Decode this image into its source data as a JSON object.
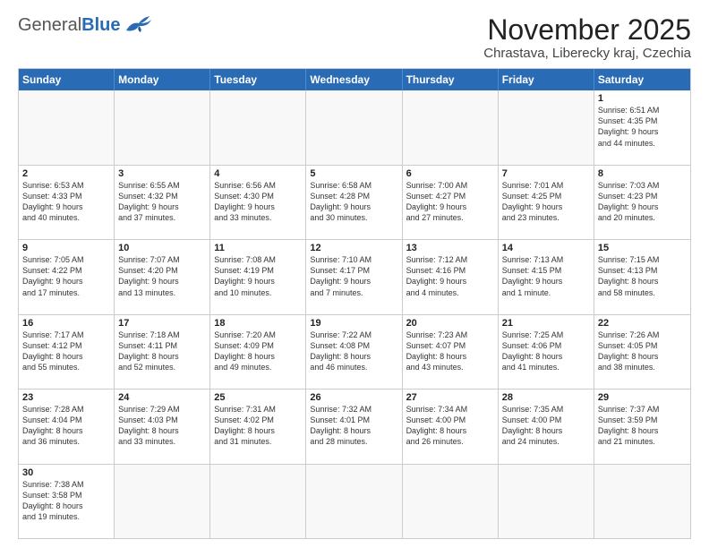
{
  "header": {
    "logo_general": "General",
    "logo_blue": "Blue",
    "title": "November 2025",
    "subtitle": "Chrastava, Liberecky kraj, Czechia"
  },
  "weekdays": [
    "Sunday",
    "Monday",
    "Tuesday",
    "Wednesday",
    "Thursday",
    "Friday",
    "Saturday"
  ],
  "rows": [
    [
      {
        "day": "",
        "info": ""
      },
      {
        "day": "",
        "info": ""
      },
      {
        "day": "",
        "info": ""
      },
      {
        "day": "",
        "info": ""
      },
      {
        "day": "",
        "info": ""
      },
      {
        "day": "",
        "info": ""
      },
      {
        "day": "1",
        "info": "Sunrise: 6:51 AM\nSunset: 4:35 PM\nDaylight: 9 hours\nand 44 minutes."
      }
    ],
    [
      {
        "day": "2",
        "info": "Sunrise: 6:53 AM\nSunset: 4:33 PM\nDaylight: 9 hours\nand 40 minutes."
      },
      {
        "day": "3",
        "info": "Sunrise: 6:55 AM\nSunset: 4:32 PM\nDaylight: 9 hours\nand 37 minutes."
      },
      {
        "day": "4",
        "info": "Sunrise: 6:56 AM\nSunset: 4:30 PM\nDaylight: 9 hours\nand 33 minutes."
      },
      {
        "day": "5",
        "info": "Sunrise: 6:58 AM\nSunset: 4:28 PM\nDaylight: 9 hours\nand 30 minutes."
      },
      {
        "day": "6",
        "info": "Sunrise: 7:00 AM\nSunset: 4:27 PM\nDaylight: 9 hours\nand 27 minutes."
      },
      {
        "day": "7",
        "info": "Sunrise: 7:01 AM\nSunset: 4:25 PM\nDaylight: 9 hours\nand 23 minutes."
      },
      {
        "day": "8",
        "info": "Sunrise: 7:03 AM\nSunset: 4:23 PM\nDaylight: 9 hours\nand 20 minutes."
      }
    ],
    [
      {
        "day": "9",
        "info": "Sunrise: 7:05 AM\nSunset: 4:22 PM\nDaylight: 9 hours\nand 17 minutes."
      },
      {
        "day": "10",
        "info": "Sunrise: 7:07 AM\nSunset: 4:20 PM\nDaylight: 9 hours\nand 13 minutes."
      },
      {
        "day": "11",
        "info": "Sunrise: 7:08 AM\nSunset: 4:19 PM\nDaylight: 9 hours\nand 10 minutes."
      },
      {
        "day": "12",
        "info": "Sunrise: 7:10 AM\nSunset: 4:17 PM\nDaylight: 9 hours\nand 7 minutes."
      },
      {
        "day": "13",
        "info": "Sunrise: 7:12 AM\nSunset: 4:16 PM\nDaylight: 9 hours\nand 4 minutes."
      },
      {
        "day": "14",
        "info": "Sunrise: 7:13 AM\nSunset: 4:15 PM\nDaylight: 9 hours\nand 1 minute."
      },
      {
        "day": "15",
        "info": "Sunrise: 7:15 AM\nSunset: 4:13 PM\nDaylight: 8 hours\nand 58 minutes."
      }
    ],
    [
      {
        "day": "16",
        "info": "Sunrise: 7:17 AM\nSunset: 4:12 PM\nDaylight: 8 hours\nand 55 minutes."
      },
      {
        "day": "17",
        "info": "Sunrise: 7:18 AM\nSunset: 4:11 PM\nDaylight: 8 hours\nand 52 minutes."
      },
      {
        "day": "18",
        "info": "Sunrise: 7:20 AM\nSunset: 4:09 PM\nDaylight: 8 hours\nand 49 minutes."
      },
      {
        "day": "19",
        "info": "Sunrise: 7:22 AM\nSunset: 4:08 PM\nDaylight: 8 hours\nand 46 minutes."
      },
      {
        "day": "20",
        "info": "Sunrise: 7:23 AM\nSunset: 4:07 PM\nDaylight: 8 hours\nand 43 minutes."
      },
      {
        "day": "21",
        "info": "Sunrise: 7:25 AM\nSunset: 4:06 PM\nDaylight: 8 hours\nand 41 minutes."
      },
      {
        "day": "22",
        "info": "Sunrise: 7:26 AM\nSunset: 4:05 PM\nDaylight: 8 hours\nand 38 minutes."
      }
    ],
    [
      {
        "day": "23",
        "info": "Sunrise: 7:28 AM\nSunset: 4:04 PM\nDaylight: 8 hours\nand 36 minutes."
      },
      {
        "day": "24",
        "info": "Sunrise: 7:29 AM\nSunset: 4:03 PM\nDaylight: 8 hours\nand 33 minutes."
      },
      {
        "day": "25",
        "info": "Sunrise: 7:31 AM\nSunset: 4:02 PM\nDaylight: 8 hours\nand 31 minutes."
      },
      {
        "day": "26",
        "info": "Sunrise: 7:32 AM\nSunset: 4:01 PM\nDaylight: 8 hours\nand 28 minutes."
      },
      {
        "day": "27",
        "info": "Sunrise: 7:34 AM\nSunset: 4:00 PM\nDaylight: 8 hours\nand 26 minutes."
      },
      {
        "day": "28",
        "info": "Sunrise: 7:35 AM\nSunset: 4:00 PM\nDaylight: 8 hours\nand 24 minutes."
      },
      {
        "day": "29",
        "info": "Sunrise: 7:37 AM\nSunset: 3:59 PM\nDaylight: 8 hours\nand 21 minutes."
      }
    ],
    [
      {
        "day": "30",
        "info": "Sunrise: 7:38 AM\nSunset: 3:58 PM\nDaylight: 8 hours\nand 19 minutes."
      },
      {
        "day": "",
        "info": ""
      },
      {
        "day": "",
        "info": ""
      },
      {
        "day": "",
        "info": ""
      },
      {
        "day": "",
        "info": ""
      },
      {
        "day": "",
        "info": ""
      },
      {
        "day": "",
        "info": ""
      }
    ]
  ]
}
